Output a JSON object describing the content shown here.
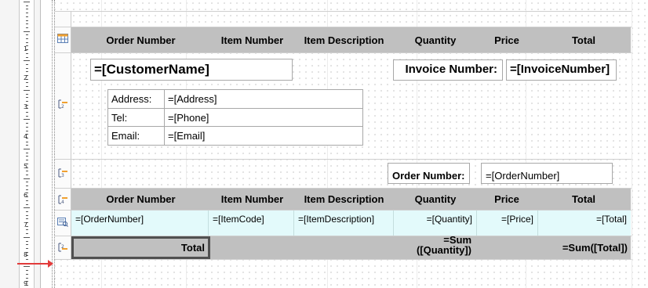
{
  "ruler": {
    "numbers": [
      "1",
      "2",
      "3",
      "4",
      "5",
      "6",
      "7",
      "8",
      "9"
    ]
  },
  "table_header": {
    "columns": [
      "Order Number",
      "Item Number",
      "Item Description",
      "Quantity",
      "Price",
      "Total"
    ]
  },
  "group_header_1": {
    "customer_name": "=[CustomerName]",
    "invoice_label": "Invoice Number:",
    "invoice_value": "=[InvoiceNumber]",
    "address_table": [
      {
        "label": "Address:",
        "value": "=[Address]"
      },
      {
        "label": "Tel:",
        "value": "=[Phone]"
      },
      {
        "label": "Email:",
        "value": "=[Email]"
      }
    ]
  },
  "group_header_2": {
    "order_label": "Order Number:",
    "order_value": "=[OrderNumber]"
  },
  "group_header_3": {
    "columns": [
      "Order Number",
      "Item Number",
      "Item Description",
      "Quantity",
      "Price",
      "Total"
    ]
  },
  "detail": {
    "cells": [
      "=[OrderNumber]",
      "=[ItemCode]",
      "=[ItemDescription]",
      "=[Quantity]",
      "=[Price]",
      "=[Total]"
    ]
  },
  "footer": {
    "total_label": "Total",
    "sum_quantity_line1": "=Sum",
    "sum_quantity_line2": "([Quantity])",
    "sum_total": "=Sum([Total])"
  },
  "colors": {
    "header_gray": "#c0c0c0",
    "detail_bg": "#e3fafb",
    "marker_red": "#e23b3b",
    "selection_border": "#505050"
  },
  "band_icons": [
    "table-header-icon",
    "group-header-1-icon",
    "group-header-2-icon",
    "group-header-3-icon",
    "detail-icon",
    "group-footer-icon"
  ]
}
